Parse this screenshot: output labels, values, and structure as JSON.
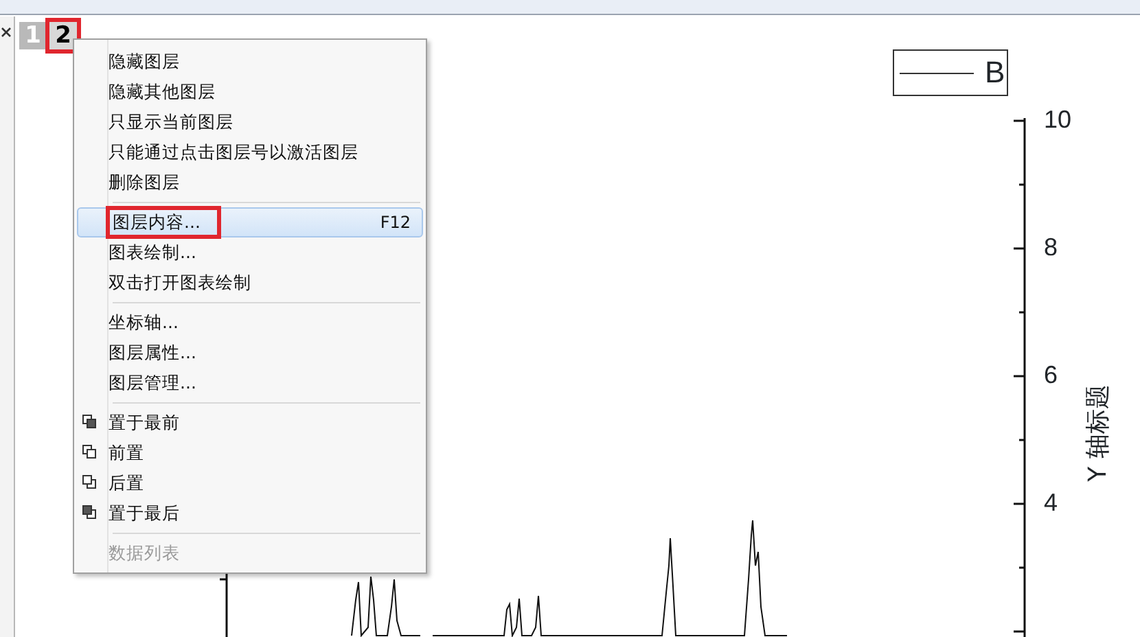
{
  "layer_tabs": [
    {
      "label": "1",
      "selected": false,
      "outlined": false
    },
    {
      "label": "2",
      "selected": true,
      "outlined": true
    }
  ],
  "context_menu": [
    {
      "kind": "item",
      "label": "隐藏图层",
      "disabled": false,
      "selected": false,
      "outlined": false
    },
    {
      "kind": "item",
      "label": "隐藏其他图层",
      "disabled": false,
      "selected": false,
      "outlined": false
    },
    {
      "kind": "item",
      "label": "只显示当前图层",
      "disabled": false,
      "selected": false,
      "outlined": false
    },
    {
      "kind": "item",
      "label": "只能通过点击图层号以激活图层",
      "disabled": false,
      "selected": false,
      "outlined": false
    },
    {
      "kind": "item",
      "label": "删除图层",
      "disabled": false,
      "selected": false,
      "outlined": false
    },
    {
      "kind": "separator"
    },
    {
      "kind": "item",
      "label": "图层内容...",
      "shortcut": "F12",
      "disabled": false,
      "selected": true,
      "outlined": true
    },
    {
      "kind": "item",
      "label": "图表绘制...",
      "disabled": false,
      "selected": false,
      "outlined": false
    },
    {
      "kind": "item",
      "label": "双击打开图表绘制",
      "disabled": false,
      "selected": false,
      "outlined": false
    },
    {
      "kind": "separator"
    },
    {
      "kind": "item",
      "label": "坐标轴...",
      "disabled": false,
      "selected": false,
      "outlined": false
    },
    {
      "kind": "item",
      "label": "图层属性...",
      "disabled": false,
      "selected": false,
      "outlined": false
    },
    {
      "kind": "item",
      "label": "图层管理...",
      "disabled": false,
      "selected": false,
      "outlined": false
    },
    {
      "kind": "separator"
    },
    {
      "kind": "front",
      "label": "置于最前",
      "disabled": false,
      "selected": false,
      "outlined": false
    },
    {
      "kind": "forward",
      "label": "前置",
      "disabled": false,
      "selected": false,
      "outlined": false
    },
    {
      "kind": "backward",
      "label": "后置",
      "disabled": false,
      "selected": false,
      "outlined": false
    },
    {
      "kind": "back",
      "label": "置于最后",
      "disabled": false,
      "selected": false,
      "outlined": false
    },
    {
      "kind": "separator"
    },
    {
      "kind": "item",
      "label": "数据列表",
      "disabled": true,
      "selected": false,
      "outlined": false
    }
  ],
  "legend": {
    "label": "B"
  },
  "right_axis": {
    "ticks": [
      "10",
      "8",
      "6",
      "4"
    ],
    "title": "Y 轴标题"
  }
}
